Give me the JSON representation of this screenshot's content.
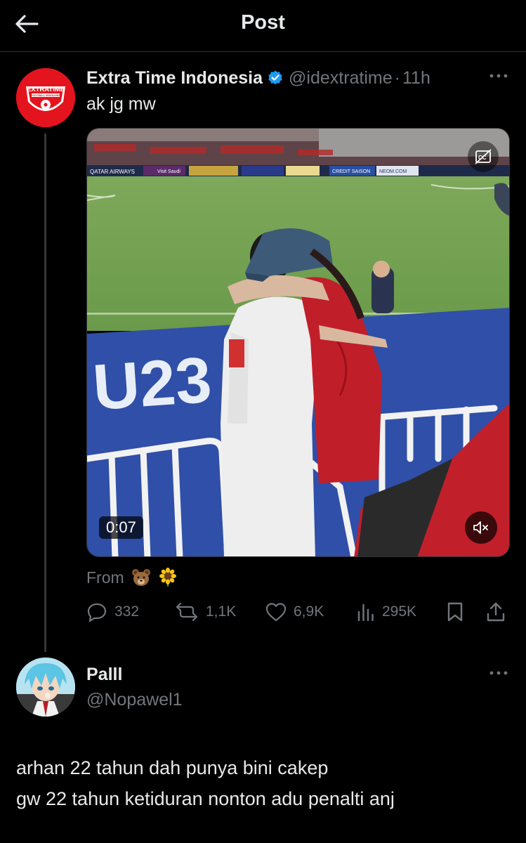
{
  "header": {
    "title": "Post"
  },
  "post": {
    "author_name": "Extra Time Indonesia",
    "verified": true,
    "handle": "@idextratime",
    "separator": "·",
    "time": "11h",
    "text": "ak jg mw",
    "avatar_logo_text": "EXTRATIME",
    "avatar_logo_subtext": "FOOTBALL HEADLINES",
    "media": {
      "duration": "0:07",
      "board_ads": [
        "QATAR AIRWAYS",
        "Visit Saudi",
        "CREDIT SAISON",
        "NEOM.COM"
      ],
      "banner_text": "U23 AS"
    },
    "from_label": "From",
    "from_emojis": [
      "bear-emoji",
      "sunflower-emoji"
    ],
    "stats": {
      "replies": "332",
      "reposts": "1,1K",
      "likes": "6,9K",
      "views": "295K"
    }
  },
  "reply": {
    "author_name": "Palll",
    "handle": "@Nopawel1",
    "text_lines": [
      "arhan 22 tahun dah punya bini cakep",
      "gw 22 tahun ketiduran nonton adu penalti anj"
    ]
  },
  "colors": {
    "background": "#000000",
    "text_primary": "#e7e9ea",
    "text_secondary": "#71767b",
    "verified": "#1d9bf0",
    "divider": "#2f3336"
  }
}
